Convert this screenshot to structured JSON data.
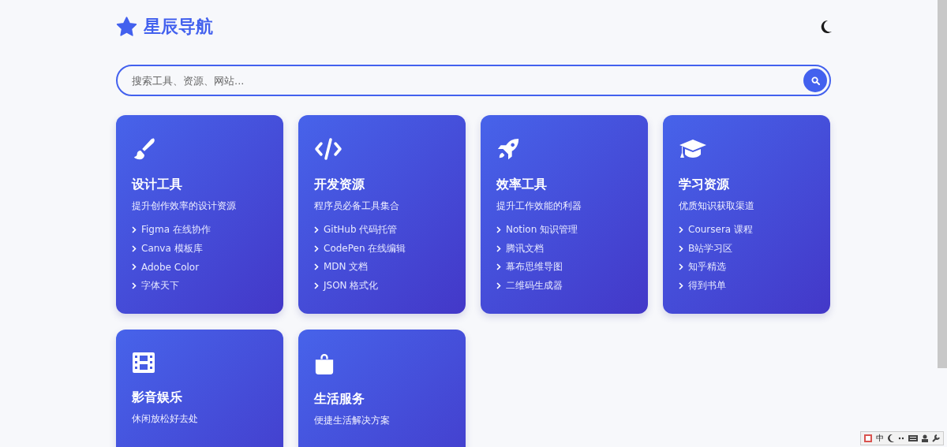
{
  "header": {
    "title": "星辰导航"
  },
  "search": {
    "placeholder": "搜索工具、资源、网站..."
  },
  "categories": [
    {
      "title": "设计工具",
      "description": "提升创作效率的设计资源",
      "links": [
        "Figma 在线协作",
        "Canva 模板库",
        "Adobe Color",
        "字体天下"
      ]
    },
    {
      "title": "开发资源",
      "description": "程序员必备工具集合",
      "links": [
        "GitHub 代码托管",
        "CodePen 在线编辑",
        "MDN 文档",
        "JSON 格式化"
      ]
    },
    {
      "title": "效率工具",
      "description": "提升工作效能的利器",
      "links": [
        "Notion 知识管理",
        "腾讯文档",
        "幕布思维导图",
        "二维码生成器"
      ]
    },
    {
      "title": "学习资源",
      "description": "优质知识获取渠道",
      "links": [
        "Coursera 课程",
        "B站学习区",
        "知乎精选",
        "得到书单"
      ]
    },
    {
      "title": "影音娱乐",
      "description": "休闲放松好去处"
    },
    {
      "title": "生活服务",
      "description": "便捷生活解决方案"
    }
  ],
  "ime_bar": {
    "mode": "中"
  }
}
